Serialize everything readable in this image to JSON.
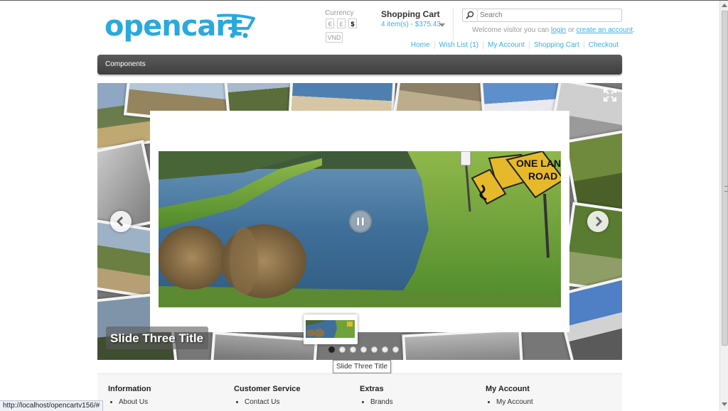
{
  "logo": {
    "text": "opencart",
    "alt": "opencart logo"
  },
  "currency": {
    "label": "Currency",
    "options": [
      "€",
      "£",
      "$",
      "VND"
    ],
    "selected": "$"
  },
  "cart": {
    "title": "Shopping Cart",
    "summary": "4 item(s) - $375.43"
  },
  "search": {
    "placeholder": "Search"
  },
  "welcome": {
    "prefix": "Welcome visitor you can",
    "login": "login",
    "or": "or",
    "create_account": "create an account",
    "suffix": "."
  },
  "top_links": [
    "Home",
    "Wish List (1)",
    "My Account",
    "Shopping Cart",
    "Checkout"
  ],
  "menu": {
    "items": [
      "Components"
    ]
  },
  "slideshow": {
    "caption": "Slide Three Title",
    "sign_text_line1": "ONE LANE",
    "sign_text_line2": "ROAD",
    "dot_count": 7,
    "active_dot": 1,
    "tooltip": "Slide Three Title"
  },
  "footer": {
    "columns": [
      {
        "title": "Information",
        "items": [
          "About Us"
        ]
      },
      {
        "title": "Customer Service",
        "items": [
          "Contact Us"
        ]
      },
      {
        "title": "Extras",
        "items": [
          "Brands"
        ]
      },
      {
        "title": "My Account",
        "items": [
          "My Account"
        ]
      }
    ]
  },
  "status_bar": {
    "url": "http://localhost/opencartv156/#"
  },
  "colors": {
    "accent": "#38b0e3",
    "logo": "#2aa9dc",
    "menu": "#4a4a4a"
  }
}
